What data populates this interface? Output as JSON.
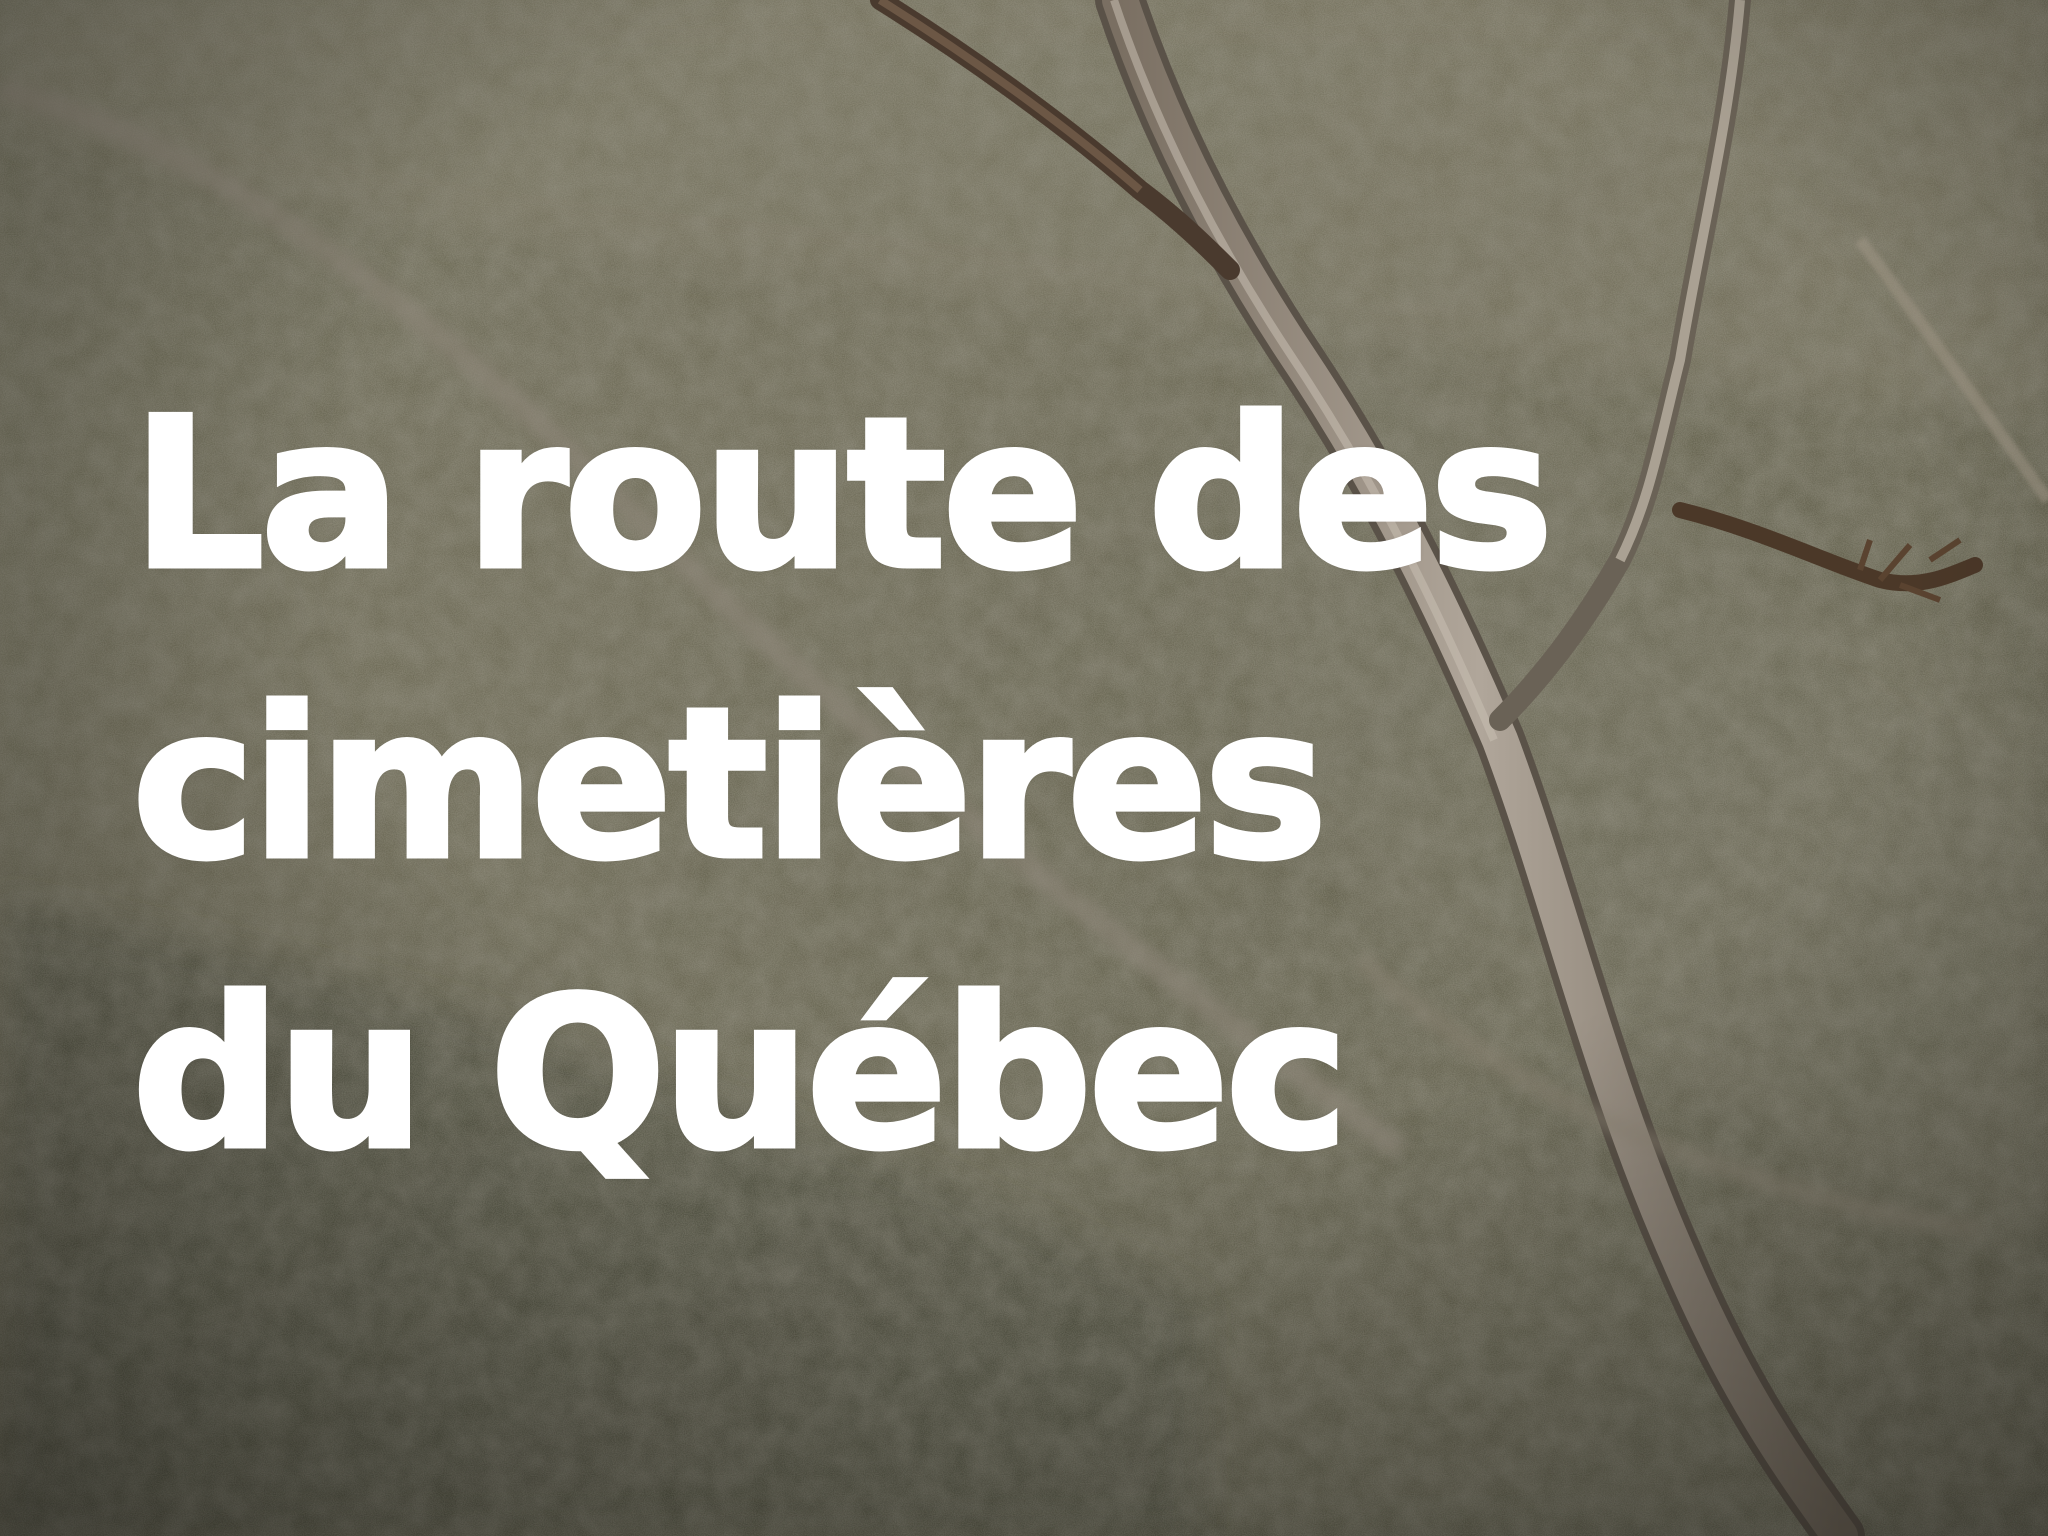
{
  "title": {
    "line1": "La route des",
    "line2": "cimetières",
    "line3": "du Québec"
  },
  "colors": {
    "text": "#ffffff",
    "background": "#55533f"
  }
}
